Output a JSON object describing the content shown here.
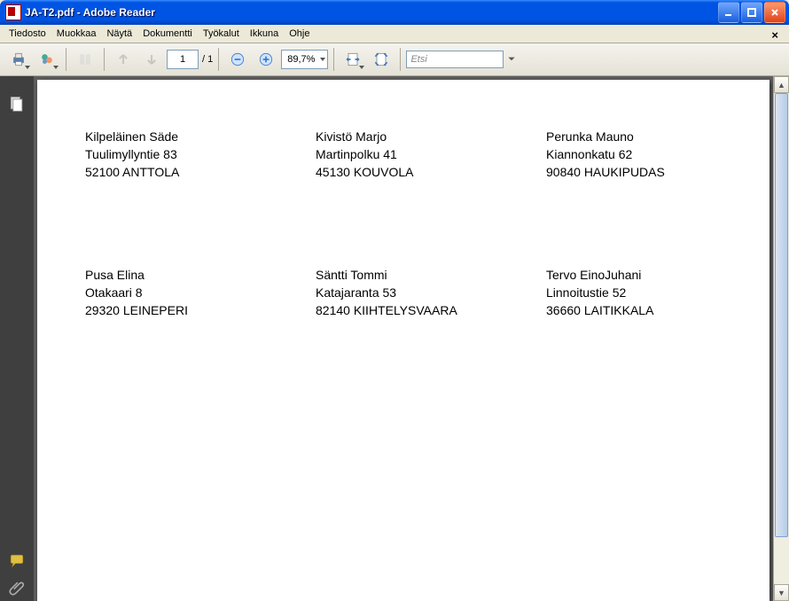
{
  "window": {
    "doc_name": "JA-T2.pdf",
    "app_name": "Adobe Reader"
  },
  "menu": {
    "file": "Tiedosto",
    "edit": "Muokkaa",
    "view": "Näytä",
    "document": "Dokumentti",
    "tools": "Työkalut",
    "window": "Ikkuna",
    "help": "Ohje"
  },
  "toolbar": {
    "page_current": "1",
    "page_total": "/ 1",
    "zoom_value": "89,7%",
    "search_placeholder": "Etsi"
  },
  "addresses": [
    {
      "name": "Kilpeläinen Säde",
      "street": "Tuulimyllyntie 83",
      "city": "52100  ANTTOLA"
    },
    {
      "name": "Kivistö Marjo",
      "street": "Martinpolku 41",
      "city": "45130  KOUVOLA"
    },
    {
      "name": "Perunka Mauno",
      "street": "Kiannonkatu 62",
      "city": "90840  HAUKIPUDAS"
    },
    {
      "name": "Pusa Elina",
      "street": "Otakaari 8",
      "city": "29320  LEINEPERI"
    },
    {
      "name": "Säntti Tommi",
      "street": "Katajaranta 53",
      "city": "82140  KIIHTELYSVAARA"
    },
    {
      "name": "Tervo EinoJuhani",
      "street": "Linnoitustie 52",
      "city": "36660  LAITIKKALA"
    }
  ]
}
